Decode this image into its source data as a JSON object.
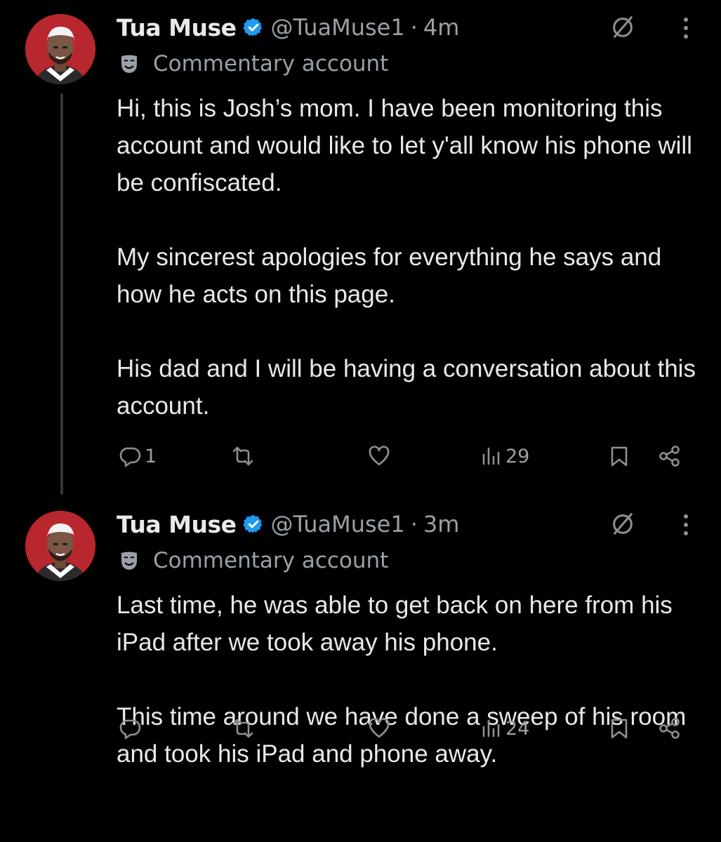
{
  "tweets": [
    {
      "author": {
        "name": "Tua Muse",
        "handle": "@TuaMuse1"
      },
      "separator": "·",
      "time": "4m",
      "label": {
        "icon": "mask-icon",
        "text": "Commentary account"
      },
      "paragraphs": [
        "Hi, this is Josh’s mom. I have been monitoring this account and would like to let y'all know his phone will be confiscated.",
        "My sincerest apologies for everything he says and how he acts on this page.",
        "His dad and I will be having a conversation about this account."
      ],
      "actions": {
        "replies": "1",
        "retweets": "",
        "likes": "",
        "views": "29"
      }
    },
    {
      "author": {
        "name": "Tua Muse",
        "handle": "@TuaMuse1"
      },
      "separator": "·",
      "time": "3m",
      "label": {
        "icon": "mask-icon",
        "text": "Commentary account"
      },
      "paragraphs": [
        "Last time, he was able to get back on here from his iPad after we took away his phone.",
        "This time around we have done a sweep of his room and took his iPad and phone away."
      ],
      "actions": {
        "replies": "",
        "retweets": "",
        "likes": "",
        "views": "24"
      }
    }
  ],
  "icons": {
    "verified": "verified-badge-icon",
    "grok": "grok-icon",
    "more": "more-icon",
    "reply": "reply-icon",
    "retweet": "retweet-icon",
    "like": "heart-icon",
    "views": "views-icon",
    "bookmark": "bookmark-icon",
    "share": "share-icon"
  },
  "colors": {
    "background": "#000000",
    "primary_text": "#e7e9ea",
    "secondary_text": "#9aa0a6",
    "verified_blue": "#1d9bf0",
    "avatar_red": "#b8262e",
    "thread_line": "#333639"
  }
}
